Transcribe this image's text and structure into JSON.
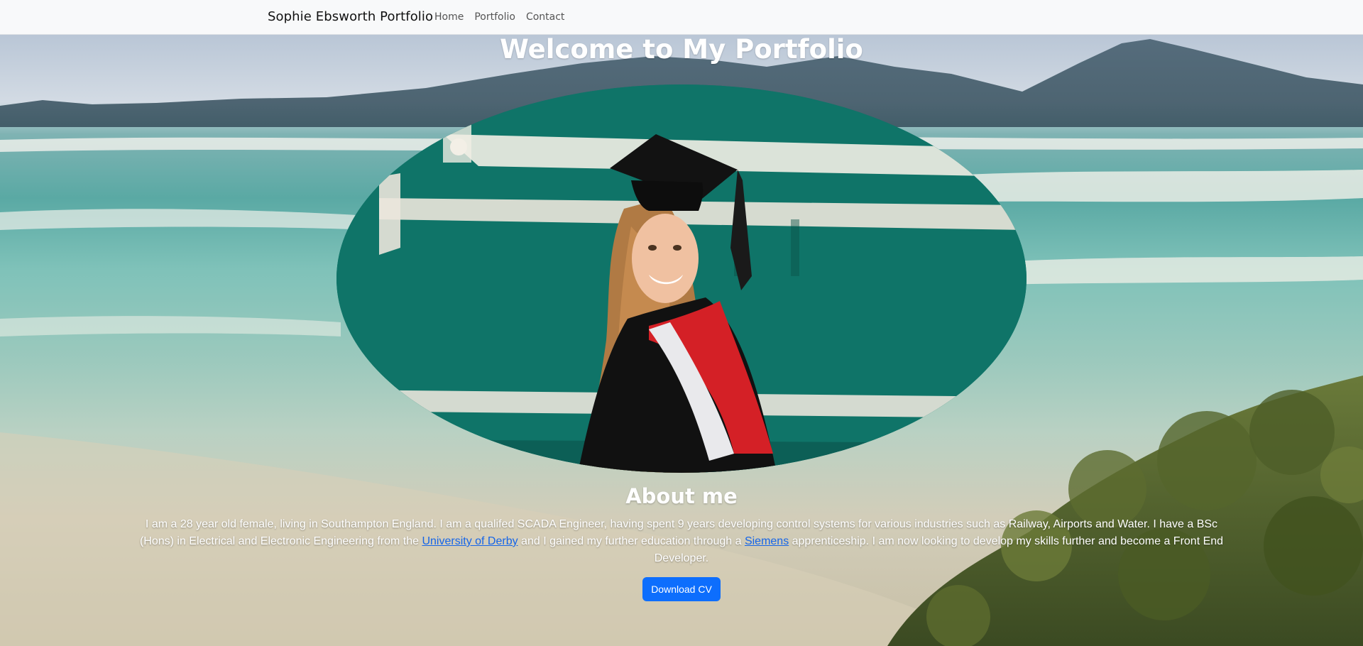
{
  "navbar": {
    "brand": "Sophie Ebsworth Portfolio",
    "links": [
      "Home",
      "Portfolio",
      "Contact"
    ]
  },
  "hero": {
    "title": "Welcome to My Portfolio"
  },
  "about": {
    "heading": "About me",
    "text_part1": "I am a 28 year old female, living in Southampton England. I am a qualifed SCADA Engineer, having spent 9 years developing control systems for various industries such as Railway, Airports and Water. I have a BSc (Hons) in Electrical and Electronic Engineering from the ",
    "link1": "University of Derby",
    "text_part2": " and I gained my further education through a ",
    "link2": "Siemens",
    "text_part3": " apprenticeship. I am now looking to develop my skills further and become a Front End Developer.",
    "button": "Download CV"
  },
  "colors": {
    "navbar_bg": "#f8f9fa",
    "button": "#0d6efd",
    "link": "#1565e8"
  }
}
